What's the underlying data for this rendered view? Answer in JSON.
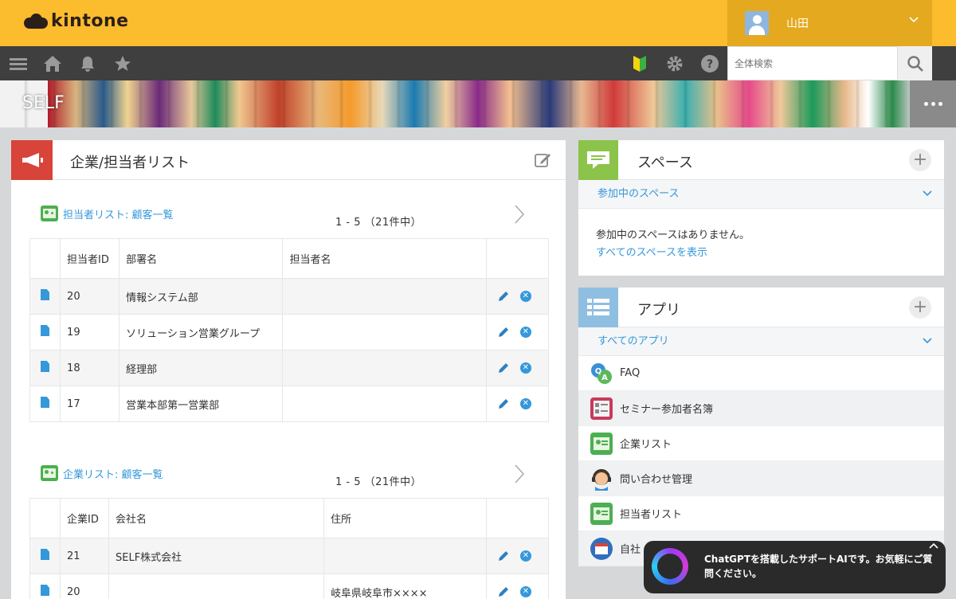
{
  "header": {
    "logo_text": "kintone",
    "user_name": "山田",
    "search_placeholder": "全体検索"
  },
  "banner": {
    "title": "SELF"
  },
  "main": {
    "title": "企業/担当者リスト",
    "lists": [
      {
        "link_label": "担当者リスト: 顧客一覧",
        "pager": "1 - 5 （21件中）",
        "columns": [
          "担当者ID",
          "部署名",
          "担当者名"
        ],
        "rows": [
          [
            "20",
            "情報システム部",
            ""
          ],
          [
            "19",
            "ソリューション営業グループ",
            ""
          ],
          [
            "18",
            "経理部",
            ""
          ],
          [
            "17",
            "営業本部第一営業部",
            ""
          ]
        ]
      },
      {
        "link_label": "企業リスト: 顧客一覧",
        "pager": "1 - 5 （21件中）",
        "columns": [
          "企業ID",
          "会社名",
          "住所"
        ],
        "rows": [
          [
            "21",
            "SELF株式会社",
            ""
          ],
          [
            "20",
            "",
            "岐阜県岐阜市××××"
          ]
        ]
      }
    ]
  },
  "space": {
    "title": "スペース",
    "sub_label": "参加中のスペース",
    "empty_text": "参加中のスペースはありません。",
    "show_all_link": "すべてのスペースを表示"
  },
  "apps": {
    "title": "アプリ",
    "sub_label": "すべてのアプリ",
    "items": [
      {
        "label": "FAQ",
        "icon": "faq-icon"
      },
      {
        "label": "セミナー参加者名簿",
        "icon": "roster-icon"
      },
      {
        "label": "企業リスト",
        "icon": "company-list-icon"
      },
      {
        "label": "問い合わせ管理",
        "icon": "support-icon"
      },
      {
        "label": "担当者リスト",
        "icon": "contact-list-icon"
      },
      {
        "label": "自社",
        "icon": "calendar-icon"
      }
    ]
  },
  "chat": {
    "message": "ChatGPTを搭載したサポートAIです。お気軽にご質問ください。"
  },
  "colors": {
    "header_yellow": "#fbbc2d",
    "user_menu": "#e4a91f",
    "toolbar": "#3f3f3f",
    "link_blue": "#3498db",
    "accent_red": "#d8433a",
    "accent_green": "#8cc34a"
  }
}
